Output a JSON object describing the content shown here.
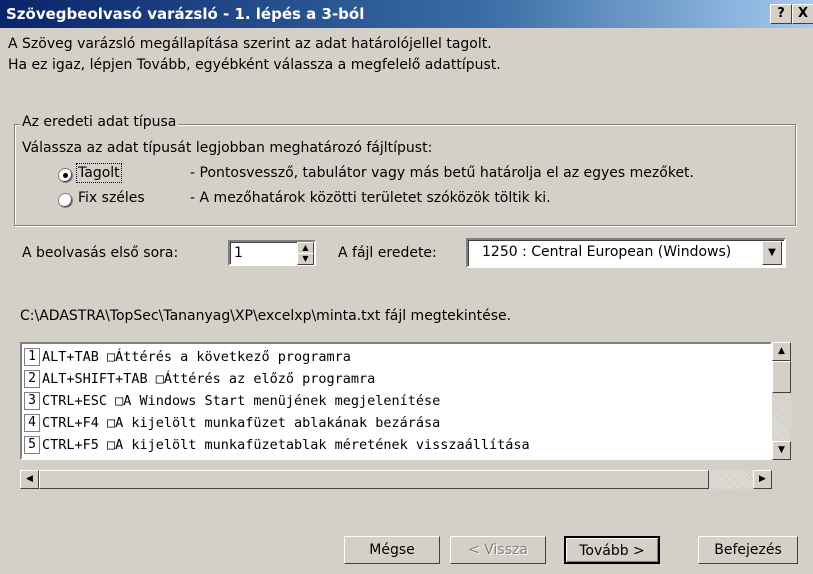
{
  "window": {
    "title": "Szövegbeolvasó varázsló - 1. lépés a 3-ból",
    "help_btn": "?",
    "close_btn": "X"
  },
  "intro": {
    "line1": "A Szöveg varázsló megállapítása szerint az adat határolójellel tagolt.",
    "line2": "Ha ez igaz, lépjen Tovább, egyébként válassza a megfelelő adattípust."
  },
  "group": {
    "title": "Az eredeti adat típusa",
    "prompt": "Válassza az adat típusát legjobban meghatározó fájltípust:",
    "options": [
      {
        "label": "Tagolt",
        "desc": "- Pontosvessző, tabulátor vagy más betű határolja el az egyes mezőket.",
        "selected": true
      },
      {
        "label": "Fix széles",
        "desc": "- A mezőhatárok közötti területet szóközök töltik ki.",
        "selected": false
      }
    ]
  },
  "start_row": {
    "label": "A beolvasás első sora:",
    "value": "1"
  },
  "origin": {
    "label": "A fájl eredete:",
    "value": "1250 : Central European (Windows)"
  },
  "preview": {
    "caption": "C:\\ADASTRA\\TopSec\\Tananyag\\XP\\excelxp\\minta.txt fájl megtekintése.",
    "rows": [
      {
        "num": "1",
        "text": "ALT+TAB □Áttérés a következő programra"
      },
      {
        "num": "2",
        "text": "ALT+SHIFT+TAB □Áttérés az előző programra"
      },
      {
        "num": "3",
        "text": "CTRL+ESC □A Windows Start menüjének megjelenítése"
      },
      {
        "num": "4",
        "text": "CTRL+F4 □A kijelölt munkafüzet ablakának bezárása"
      },
      {
        "num": "5",
        "text": "CTRL+F5 □A kijelölt munkafüzetablak méretének visszaállítása"
      }
    ]
  },
  "buttons": {
    "cancel": "Mégse",
    "back": "< Vissza",
    "next": "Tovább >",
    "finish": "Befejezés"
  },
  "icons": {
    "up": "scroll-up-icon",
    "down": "scroll-down-icon",
    "left": "scroll-left-icon",
    "right": "scroll-right-icon",
    "combo": "chevron-down-icon"
  }
}
